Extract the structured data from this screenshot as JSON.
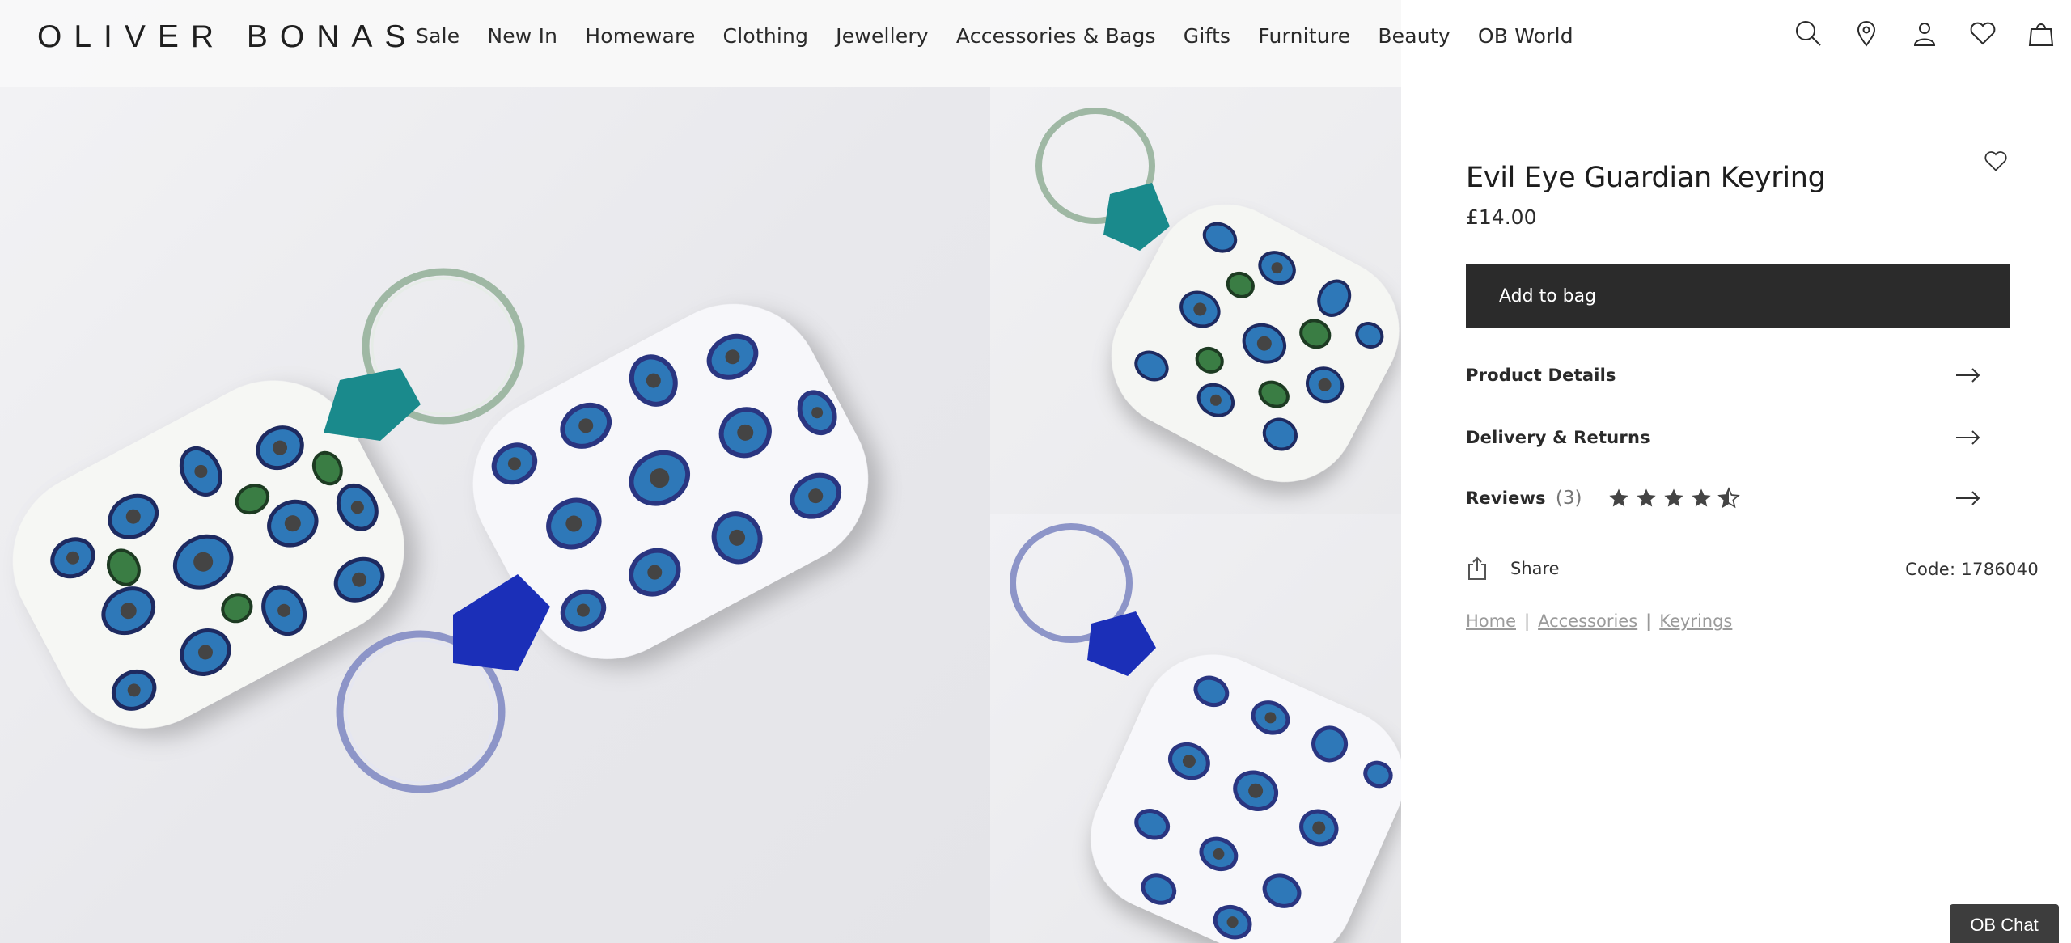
{
  "brand": {
    "logo_text": "OLIVER BONAS"
  },
  "nav": {
    "items": [
      {
        "label": "Sale"
      },
      {
        "label": "New In"
      },
      {
        "label": "Homeware"
      },
      {
        "label": "Clothing"
      },
      {
        "label": "Jewellery"
      },
      {
        "label": "Accessories & Bags"
      },
      {
        "label": "Gifts"
      },
      {
        "label": "Furniture"
      },
      {
        "label": "Beauty"
      },
      {
        "label": "OB World"
      }
    ]
  },
  "header_icons": [
    "search-icon",
    "store-locator-icon",
    "account-icon",
    "wishlist-icon",
    "bag-icon"
  ],
  "product": {
    "title": "Evil Eye Guardian Keyring",
    "price": "£14.00",
    "add_to_bag_label": "Add to bag",
    "details_label": "Product Details",
    "delivery_label": "Delivery & Returns",
    "reviews_label": "Reviews",
    "reviews_count": "(3)",
    "rating": 4.5,
    "rating_max": 5,
    "share_label": "Share",
    "code": "Code: 1786040"
  },
  "breadcrumbs": [
    {
      "label": "Home"
    },
    {
      "label": "Accessories"
    },
    {
      "label": "Keyrings"
    }
  ],
  "chat": {
    "label": "OB Chat"
  },
  "colors": {
    "button_bg": "#2b2b2b",
    "chat_bg": "#3d3d3d",
    "eye_blue": "#2e78b8",
    "eye_navy": "#2a3580",
    "eye_green": "#2f7a3e",
    "teal_tab": "#1a8a8c",
    "blue_tab": "#1b2fb8"
  }
}
